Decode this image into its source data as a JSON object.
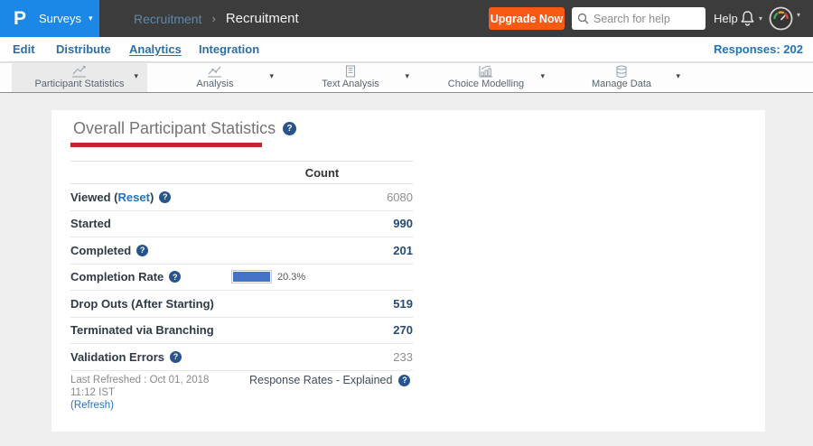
{
  "glyphs": {
    "caret": "▾",
    "separator": "›",
    "help": "?"
  },
  "header": {
    "logo": "P",
    "product_menu": "Surveys",
    "breadcrumb": {
      "parent": "Recruitment",
      "current": "Recruitment"
    },
    "upgrade_button": "Upgrade Now",
    "search": {
      "placeholder": "Search for help"
    },
    "help_label": "Help"
  },
  "nav": {
    "items": [
      {
        "label": "Edit"
      },
      {
        "label": "Distribute"
      },
      {
        "label": "Analytics"
      },
      {
        "label": "Integration"
      }
    ],
    "responses_label": "Responses: 202"
  },
  "toolbar": {
    "tabs": [
      {
        "label": "Participant Statistics",
        "icon": "line-chart-icon",
        "selected": true
      },
      {
        "label": "Analysis",
        "icon": "trend-chart-icon",
        "selected": false
      },
      {
        "label": "Text Analysis",
        "icon": "document-icon",
        "selected": false
      },
      {
        "label": "Choice Modelling",
        "icon": "bar-chart-icon",
        "selected": false
      },
      {
        "label": "Manage Data",
        "icon": "database-icon",
        "selected": false
      }
    ]
  },
  "main": {
    "title": "Overall Participant Statistics",
    "accent_color": "#c1272d",
    "table": {
      "count_header": "Count",
      "completion_rate_percent": 20.3,
      "bar_color": "#4472c4",
      "rows": [
        {
          "prefix": "Viewed ( ",
          "link": "Reset",
          "suffix": " )",
          "help": true,
          "value": "6080",
          "style": "muted"
        },
        {
          "prefix": "Started",
          "help": false,
          "value": "990",
          "style": "strong"
        },
        {
          "prefix": "Completed",
          "help": true,
          "value": "201",
          "style": "strong"
        },
        {
          "prefix": "Completion Rate",
          "help": true,
          "value": "20.3%",
          "style": "bar"
        },
        {
          "prefix": "Drop Outs (After Starting)",
          "help": false,
          "value": "519",
          "style": "strong"
        },
        {
          "prefix": "Terminated via Branching",
          "help": false,
          "value": "270",
          "style": "strong"
        },
        {
          "prefix": "Validation Errors",
          "help": true,
          "value": "233",
          "style": "muted"
        }
      ]
    },
    "footer": {
      "last_refreshed": "Last Refreshed : Oct 01, 2018 11:12 IST",
      "refresh_link": "(Refresh)",
      "response_rates": "Response Rates - Explained"
    }
  }
}
